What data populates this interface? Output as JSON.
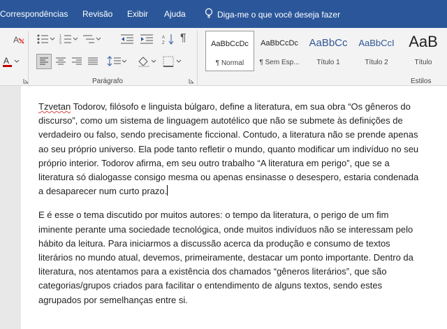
{
  "menubar": {
    "tabs": [
      "Correspondências",
      "Revisão",
      "Exibir",
      "Ajuda"
    ],
    "tell_me": "Diga-me o que você deseja fazer"
  },
  "ribbon": {
    "paragraph_group_label": "Parágrafo",
    "styles_group_label": "Estilos",
    "styles": [
      {
        "preview": "AaBbCcDc",
        "name": "¶ Normal"
      },
      {
        "preview": "AaBbCcDc",
        "name": "¶ Sem Esp..."
      },
      {
        "preview": "AaBbCc",
        "name": "Título 1"
      },
      {
        "preview": "AaBbCcI",
        "name": "Título 2"
      },
      {
        "preview": "AaB",
        "name": "Título"
      }
    ],
    "font_color": "#c00000"
  },
  "document": {
    "p1": {
      "first_word": "Tzvetan",
      "text": " Todorov, filósofo e linguista búlgaro, define a literatura, em sua obra “Os gêneros do discurso”, como um sistema de linguagem autotélico que não se submete às definições de verdadeiro ou falso, sendo precisamente ficcional. Contudo, a literatura não se prende apenas ao seu próprio universo. Ela pode tanto refletir o mundo, quanto modificar um indivíduo no seu próprio interior. Todorov afirma, em seu outro trabalho “A literatura em perigo”, que se a literatura só dialogasse consigo mesma ou apenas ensinasse o desespero, estaria condenada a desaparecer num curto prazo."
    },
    "p2": "E é esse o tema discutido por muitos autores: o tempo da literatura, o perigo de um fim iminente perante uma sociedade tecnológica, onde muitos indivíduos não se interessam pelo hábito da leitura. Para iniciarmos a discussão acerca da produção e consumo de textos literários no mundo atual, devemos, primeiramente, destacar um ponto importante. Dentro da literatura, nos atentamos para a existência dos chamados “gêneros literários”, que são categorias/grupos criados para facilitar o entendimento de alguns textos, sendo estes agrupados por semelhanças entre si."
  }
}
